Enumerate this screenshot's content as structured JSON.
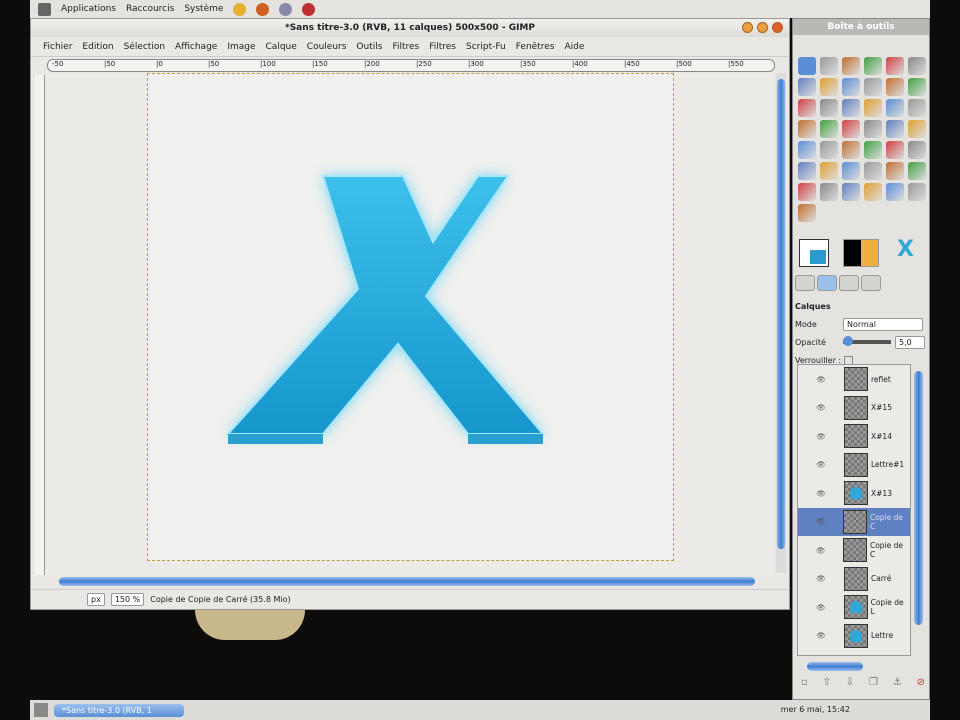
{
  "panel": {
    "menus": [
      "Applications",
      "Raccourcis",
      "Système"
    ]
  },
  "window": {
    "title": "*Sans titre-3.0 (RVB, 11 calques) 500x500 - GIMP",
    "menu": [
      "Fichier",
      "Edition",
      "Sélection",
      "Affichage",
      "Image",
      "Calque",
      "Couleurs",
      "Outils",
      "Filtres",
      "Filtres",
      "Script-Fu",
      "Fenêtres",
      "Aide"
    ],
    "ruler": [
      "-50",
      "|50",
      "|0",
      "|50",
      "|100",
      "|150",
      "|200",
      "|250",
      "|300",
      "|350",
      "|400",
      "|450",
      "|500",
      "|550"
    ],
    "letter": "X",
    "status": {
      "unit": "px",
      "zoom": "150 %",
      "info": "Copie de Copie de Carré (35.8 Mio)"
    }
  },
  "toolbox": {
    "title": "Boîte à outils",
    "tools": [
      "rect-select",
      "ellipse-select",
      "free-select",
      "fuzzy-select",
      "color-select",
      "scissors",
      "foreground-select",
      "paths",
      "color-picker",
      "zoom",
      "measure",
      "move",
      "align",
      "crop",
      "rotate",
      "scale",
      "shear",
      "perspective",
      "flip",
      "text",
      "bucket",
      "blend",
      "pencil",
      "paintbrush",
      "eraser",
      "airbrush",
      "ink",
      "clone",
      "heal",
      "perspective-clone",
      "smudge",
      "blur",
      "dodge",
      "levels",
      "curves",
      "threshold",
      "color-balance",
      "hue-sat",
      "brightness",
      "colorize",
      "posterize",
      "desaturate",
      "gimp-logo"
    ],
    "colors": {
      "fg": "#000000",
      "bg": "#ffffff",
      "accent": "#2fa8d8"
    },
    "layers": {
      "title": "Calques",
      "mode_label": "Mode",
      "mode": "Normal",
      "opacity_label": "Opacité",
      "opacity": "5,0",
      "opacity_fraction": 0.05,
      "lock_label": "Verrouiller :",
      "items": [
        {
          "name": "reflet",
          "thumb": "gray"
        },
        {
          "name": "X#15",
          "thumb": "gray"
        },
        {
          "name": "X#14",
          "thumb": "gray"
        },
        {
          "name": "Lettre#1",
          "thumb": "gray"
        },
        {
          "name": "X#13",
          "thumb": "cyan"
        },
        {
          "name": "Copie de C",
          "thumb": "gray",
          "selected": true
        },
        {
          "name": "Copie de C",
          "thumb": "gray"
        },
        {
          "name": "Carré",
          "thumb": "gray"
        },
        {
          "name": "Copie de L",
          "thumb": "cyan"
        },
        {
          "name": "Lettre",
          "thumb": "cyan"
        }
      ]
    }
  },
  "taskbar": {
    "task": "*Sans titre-3.0 (RVB, 1",
    "clock": "mer  6 mai, 15:42"
  }
}
